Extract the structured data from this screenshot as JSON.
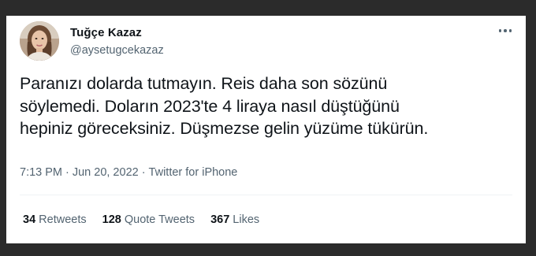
{
  "user": {
    "name": "Tuğçe Kazaz",
    "handle": "@aysetugcekazaz",
    "avatar_icon": "profile-photo"
  },
  "tweet": {
    "lines": [
      "Paranızı dolarda tutmayın. Reis daha son sözünü",
      "söylemedi. Doların 2023'te 4 liraya nasıl düştüğünü",
      "hepiniz göreceksiniz. Düşmezse gelin yüzüme tükürün."
    ]
  },
  "meta": {
    "time": "7:13 PM",
    "separator": "·",
    "date": "Jun 20, 2022",
    "source": "Twitter for iPhone"
  },
  "stats": {
    "retweets_count": "34",
    "retweets_label": "Retweets",
    "quotes_count": "128",
    "quotes_label": "Quote Tweets",
    "likes_count": "367",
    "likes_label": "Likes"
  },
  "colors": {
    "background": "#2b2b2b",
    "card": "#ffffff",
    "text_primary": "#0f1419",
    "text_secondary": "#536471"
  },
  "icons": {
    "more": "more-horizontal-icon"
  }
}
